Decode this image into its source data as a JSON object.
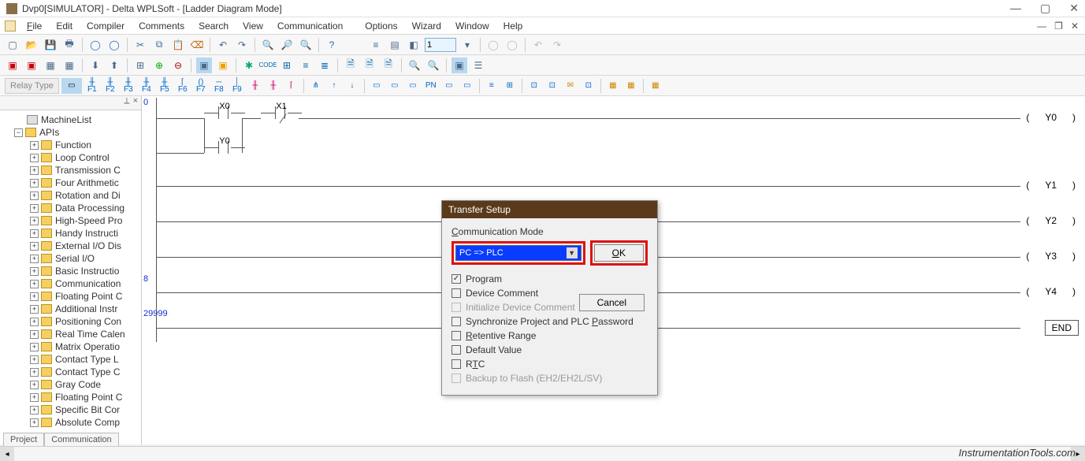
{
  "window": {
    "title": "Dvp0[SIMULATOR] - Delta WPLSoft - [Ladder Diagram Mode]",
    "controls": {
      "min": "—",
      "max": "▢",
      "close": "✕"
    }
  },
  "menubar": {
    "file": "File",
    "edit": "Edit",
    "compiler": "Compiler",
    "comments": "Comments",
    "search": "Search",
    "view": "View",
    "communication": "Communication",
    "options": "Options",
    "wizard": "Wizard",
    "window": "Window",
    "help": "Help"
  },
  "toolbar": {
    "step_value": "1",
    "relay_label": "Relay Type"
  },
  "sidebar": {
    "root_machine": "MachineList",
    "root_apis": "APIs",
    "items": [
      "Function",
      "Loop Control",
      "Transmission C",
      "Four Arithmetic",
      "Rotation and Di",
      "Data Processing",
      "High-Speed Pro",
      "Handy Instructi",
      "External I/O Dis",
      "Serial I/O",
      "Basic Instructio",
      "Communication",
      "Floating Point C",
      "Additional Instr",
      "Positioning Con",
      "Real Time Calen",
      "Matrix Operatio",
      "Contact Type L",
      "Contact Type C",
      "Gray Code",
      "Floating Point C",
      "Specific Bit Cor",
      "Absolute Comp"
    ],
    "tabs": {
      "project": "Project",
      "communication": "Communication"
    }
  },
  "ladder": {
    "rows": [
      "0",
      "8",
      "29999"
    ],
    "contacts": {
      "x0": "X0",
      "x1": "X1",
      "y0": "Y0"
    },
    "coils": [
      "Y0",
      "Y1",
      "Y2",
      "Y3",
      "Y4"
    ],
    "end": "END"
  },
  "dialog": {
    "title": "Transfer Setup",
    "comm_mode_label": "Communication Mode",
    "combo_value": "PC => PLC",
    "ok": "OK",
    "cancel": "Cancel",
    "checks": {
      "program": "Program",
      "device_comment": "Device Comment",
      "init_comment": "Initialize Device Comment",
      "sync_pw": "Synchronize Project and PLC Password",
      "retentive": "Retentive Range",
      "default_val": "Default Value",
      "rtc": "RTC",
      "backup": "Backup to Flash (EH2/EH2L/SV)"
    }
  },
  "footer": {
    "credit": "InstrumentationTools.com"
  }
}
